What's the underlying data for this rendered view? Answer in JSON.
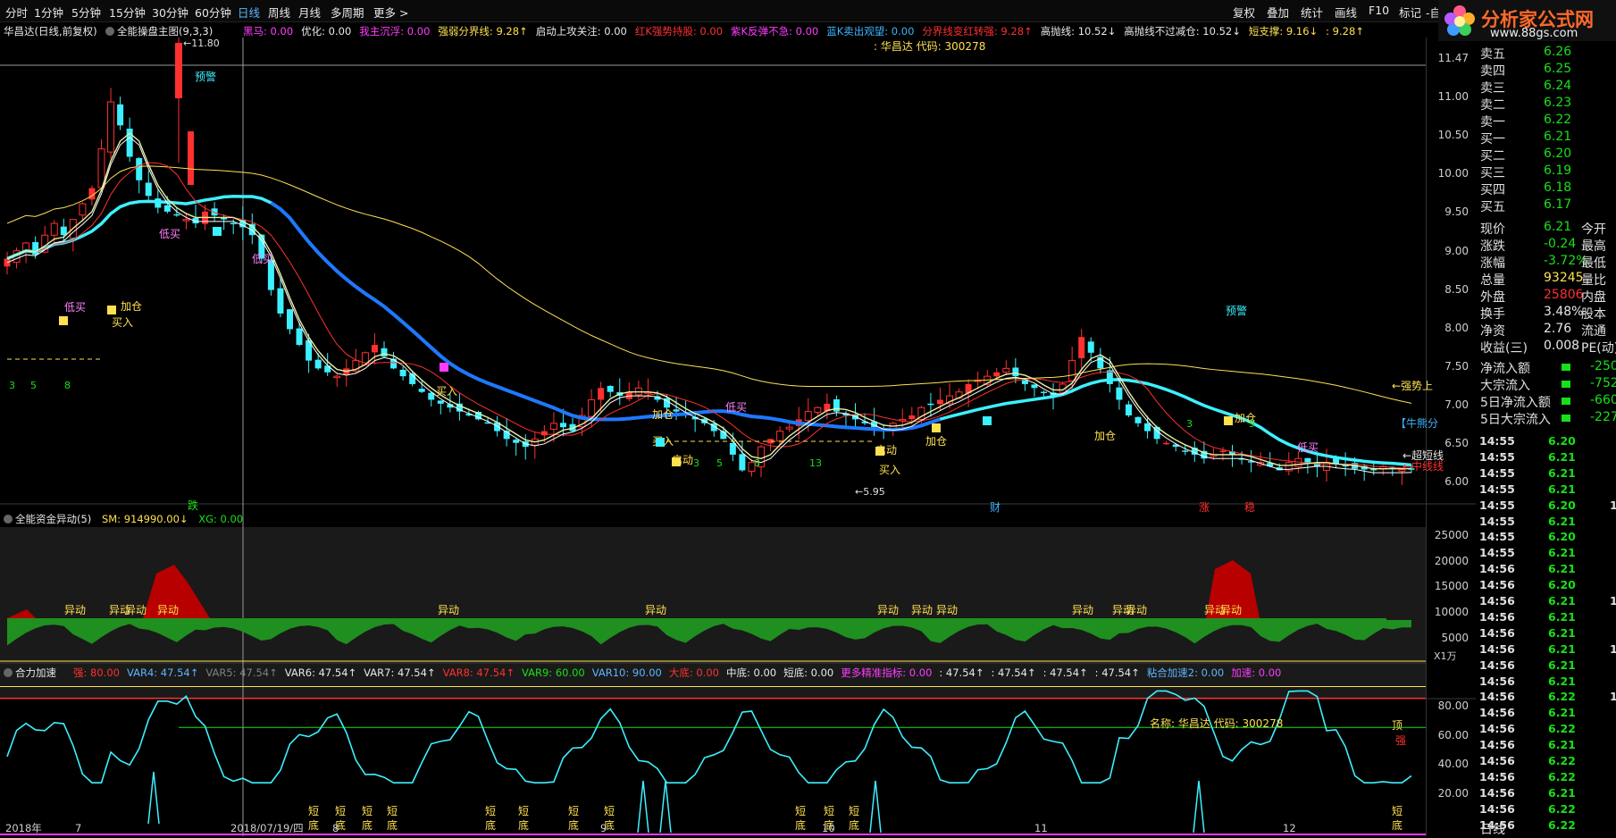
{
  "toolbar": {
    "timeframes": [
      "分时",
      "1分钟",
      "5分钟",
      "15分钟",
      "30分钟",
      "60分钟",
      "日线",
      "周线",
      "月线",
      "多周期",
      "更多 >"
    ],
    "active_index": 6,
    "right_items": [
      "复权",
      "叠加",
      "统计",
      "画线",
      "F10",
      "标记",
      "-自"
    ]
  },
  "logo": {
    "brand": "分析家公式网",
    "url": "www.88gs.com"
  },
  "main_panel": {
    "stock_title": "华昌达(日线,前复权)",
    "formula_title": "全能操盘主图(9,3,3)",
    "indicators": [
      {
        "text": "黑马: 0.00",
        "color": "#ff3cff"
      },
      {
        "text": "优化: 0.00",
        "color": "#e8e8e8"
      },
      {
        "text": "我主沉浮: 0.00",
        "color": "#ff3cff"
      },
      {
        "text": "强弱分界线: 9.28↑",
        "color": "#ffe050"
      },
      {
        "text": "启动上攻关注: 0.00",
        "color": "#e8e8e8"
      },
      {
        "text": "红K强势持股: 0.00",
        "color": "#ff3030"
      },
      {
        "text": "紫K反弹不急: 0.00",
        "color": "#ff3cff"
      },
      {
        "text": "蓝K卖出观望: 0.00",
        "color": "#3cb4ff"
      },
      {
        "text": "分界线变红转强: 9.28↑",
        "color": "#ff3030"
      },
      {
        "text": "高抛线: 10.52↓",
        "color": "#e8e8e8"
      },
      {
        "text": "高抛线不过减仓: 10.52↓",
        "color": "#e8e8e8"
      },
      {
        "text": "短支撑: 9.16↓",
        "color": "#ffe050"
      },
      {
        "text": ": 9.28↑",
        "color": "#ffe050"
      }
    ],
    "name_code": ": 华昌达 代码: 300278",
    "price_axis": [
      "11.47",
      "11.00",
      "10.50",
      "10.00",
      "9.50",
      "9.00",
      "8.50",
      "8.00",
      "7.50",
      "7.00",
      "6.50",
      "6.00"
    ],
    "high_label": "←11.80",
    "low_label": "←5.95",
    "annotations": [
      {
        "t": "预警",
        "c": "#3cf0ff"
      },
      {
        "t": "低买",
        "c": "#ff80ff"
      },
      {
        "t": "低买",
        "c": "#ff80ff"
      },
      {
        "t": "低买",
        "c": "#ff80ff"
      },
      {
        "t": "加仓",
        "c": "#ffe050"
      },
      {
        "t": "买入",
        "c": "#ffe050"
      },
      {
        "t": "买入",
        "c": "#ffe050"
      },
      {
        "t": "加仓",
        "c": "#ffe050"
      },
      {
        "t": "买入",
        "c": "#ffe050"
      },
      {
        "t": "低买",
        "c": "#ff80ff"
      },
      {
        "t": "启动",
        "c": "#ffe050"
      },
      {
        "t": "启动",
        "c": "#ffe050"
      },
      {
        "t": "买入",
        "c": "#ffe050"
      },
      {
        "t": "加仓",
        "c": "#ffe050"
      },
      {
        "t": "加仓",
        "c": "#ffe050"
      },
      {
        "t": "预警",
        "c": "#3cf0ff"
      },
      {
        "t": "加仓",
        "c": "#ffe050"
      },
      {
        "t": "低买",
        "c": "#ff80ff"
      },
      {
        "t": "←强势上",
        "c": "#ffe050"
      },
      {
        "t": "【牛熊分",
        "c": "#3cb4ff"
      },
      {
        "t": "←超短线",
        "c": "#e8e8e8"
      },
      {
        "t": "←中线线",
        "c": "#ff3030"
      },
      {
        "t": "跌",
        "c": "#18e018"
      },
      {
        "t": "财",
        "c": "#3cb4ff"
      },
      {
        "t": "涨",
        "c": "#ff3030"
      },
      {
        "t": "稳",
        "c": "#ff3030"
      }
    ],
    "count_labels": [
      "3",
      "5",
      "8",
      "3",
      "5",
      "8",
      "13",
      "3",
      "5"
    ]
  },
  "fund_panel": {
    "title": "全能资金异动(5)",
    "sm": "SM: 914990.00↓",
    "xg": "XG: 0.00",
    "axis": [
      "25000",
      "20000",
      "15000",
      "10000",
      "5000"
    ],
    "unit": "X1万",
    "label": "异动"
  },
  "accel_panel": {
    "title": "合力加速",
    "indicators": [
      {
        "text": "强: 80.00",
        "color": "#ff3030"
      },
      {
        "text": "VAR4: 47.54↑",
        "color": "#5fb4ff"
      },
      {
        "text": "VAR5: 47.54↑",
        "color": "#808080"
      },
      {
        "text": "VAR6: 47.54↑",
        "color": "#e8e8e8"
      },
      {
        "text": "VAR7: 47.54↑",
        "color": "#e8e8e8"
      },
      {
        "text": "VAR8: 47.54↑",
        "color": "#ff3030"
      },
      {
        "text": "VAR9: 60.00",
        "color": "#18e018"
      },
      {
        "text": "VAR10: 90.00",
        "color": "#5fb4ff"
      },
      {
        "text": "大底: 0.00",
        "color": "#ff3030"
      },
      {
        "text": "中底: 0.00",
        "color": "#e8e8e8"
      },
      {
        "text": "短底: 0.00",
        "color": "#e8e8e8"
      },
      {
        "text": "更多精准指标: 0.00",
        "color": "#ff3cff"
      },
      {
        "text": ": 47.54↑",
        "color": "#e8e8e8"
      },
      {
        "text": ": 47.54↑",
        "color": "#e8e8e8"
      },
      {
        "text": ": 47.54↑",
        "color": "#e8e8e8"
      },
      {
        "text": ": 47.54↑",
        "color": "#e8e8e8"
      },
      {
        "text": "粘合加速2: 0.00",
        "color": "#5fb4ff"
      },
      {
        "text": "加速: 0.00",
        "color": "#ff3cff"
      }
    ],
    "name_code": "名称: 华昌达 代码: 300278",
    "top_label": "顶",
    "strong_label": "强",
    "axis": [
      "80.00",
      "60.00",
      "40.00",
      "20.00"
    ],
    "bottom_labels": [
      "短",
      "底",
      "中",
      "底"
    ]
  },
  "date_axis": [
    "2018年",
    "7",
    "2018/07/19/四",
    "8",
    "9",
    "10",
    "11",
    "12"
  ],
  "right_panel": {
    "orders": [
      {
        "k": "卖五",
        "v": "6.26"
      },
      {
        "k": "卖四",
        "v": "6.25"
      },
      {
        "k": "卖三",
        "v": "6.24"
      },
      {
        "k": "卖二",
        "v": "6.23"
      },
      {
        "k": "卖一",
        "v": "6.22"
      },
      {
        "k": "买一",
        "v": "6.21"
      },
      {
        "k": "买二",
        "v": "6.20"
      },
      {
        "k": "买三",
        "v": "6.19"
      },
      {
        "k": "买四",
        "v": "6.18"
      },
      {
        "k": "买五",
        "v": "6.17"
      }
    ],
    "stats": [
      {
        "k": "现价",
        "v": "6.21",
        "x": "今开",
        "vc": "#18e018"
      },
      {
        "k": "涨跌",
        "v": "-0.24",
        "x": "最高",
        "vc": "#18e018"
      },
      {
        "k": "涨幅",
        "v": "-3.72%",
        "x": "最低",
        "vc": "#18e018"
      },
      {
        "k": "总量",
        "v": "93245",
        "x": "量比",
        "vc": "#ffe050"
      },
      {
        "k": "外盘",
        "v": "25806",
        "x": "内盘",
        "vc": "#ff3030"
      },
      {
        "k": "换手",
        "v": "3.48%",
        "x": "股本",
        "vc": "#e8e8e8"
      },
      {
        "k": "净资",
        "v": "2.76",
        "x": "流通",
        "vc": "#e8e8e8"
      },
      {
        "k": "收益(三)",
        "v": "0.008",
        "x": "PE(动)",
        "vc": "#e8e8e8"
      }
    ],
    "flows": [
      {
        "k": "净流入额",
        "v": "-250"
      },
      {
        "k": "大宗流入",
        "v": "-752"
      },
      {
        "k": "5日净流入额",
        "v": "-660"
      },
      {
        "k": "5日大宗流入",
        "v": "-227"
      }
    ],
    "ticks": [
      {
        "t": "14:55",
        "p": "6.20",
        "q": ""
      },
      {
        "t": "14:55",
        "p": "6.21",
        "q": ""
      },
      {
        "t": "14:55",
        "p": "6.21",
        "q": ""
      },
      {
        "t": "14:55",
        "p": "6.21",
        "q": ""
      },
      {
        "t": "14:55",
        "p": "6.20",
        "q": "1"
      },
      {
        "t": "14:55",
        "p": "6.21",
        "q": ""
      },
      {
        "t": "14:55",
        "p": "6.20",
        "q": ""
      },
      {
        "t": "14:55",
        "p": "6.21",
        "q": ""
      },
      {
        "t": "14:56",
        "p": "6.21",
        "q": ""
      },
      {
        "t": "14:56",
        "p": "6.20",
        "q": ""
      },
      {
        "t": "14:56",
        "p": "6.21",
        "q": "1"
      },
      {
        "t": "14:56",
        "p": "6.21",
        "q": ""
      },
      {
        "t": "14:56",
        "p": "6.21",
        "q": ""
      },
      {
        "t": "14:56",
        "p": "6.21",
        "q": "1"
      },
      {
        "t": "14:56",
        "p": "6.21",
        "q": ""
      },
      {
        "t": "14:56",
        "p": "6.21",
        "q": ""
      },
      {
        "t": "14:56",
        "p": "6.22",
        "q": "1"
      },
      {
        "t": "14:56",
        "p": "6.21",
        "q": ""
      },
      {
        "t": "14:56",
        "p": "6.22",
        "q": ""
      },
      {
        "t": "14:56",
        "p": "6.21",
        "q": ""
      },
      {
        "t": "14:56",
        "p": "6.22",
        "q": ""
      },
      {
        "t": "14:56",
        "p": "6.22",
        "q": ""
      },
      {
        "t": "14:56",
        "p": "6.21",
        "q": ""
      },
      {
        "t": "14:56",
        "p": "6.22",
        "q": ""
      },
      {
        "t": "14:56",
        "p": "6.22",
        "q": ""
      }
    ],
    "bottom_label": "日线"
  },
  "colors": {
    "bg": "#000000",
    "up": "#ff3030",
    "down": "#3cf0ff",
    "yellow": "#ffe050",
    "magenta": "#ff3cff",
    "green": "#18e018",
    "blue": "#1e78ff",
    "red_fill": "#b80000",
    "green_fill": "#1f8f1f"
  }
}
